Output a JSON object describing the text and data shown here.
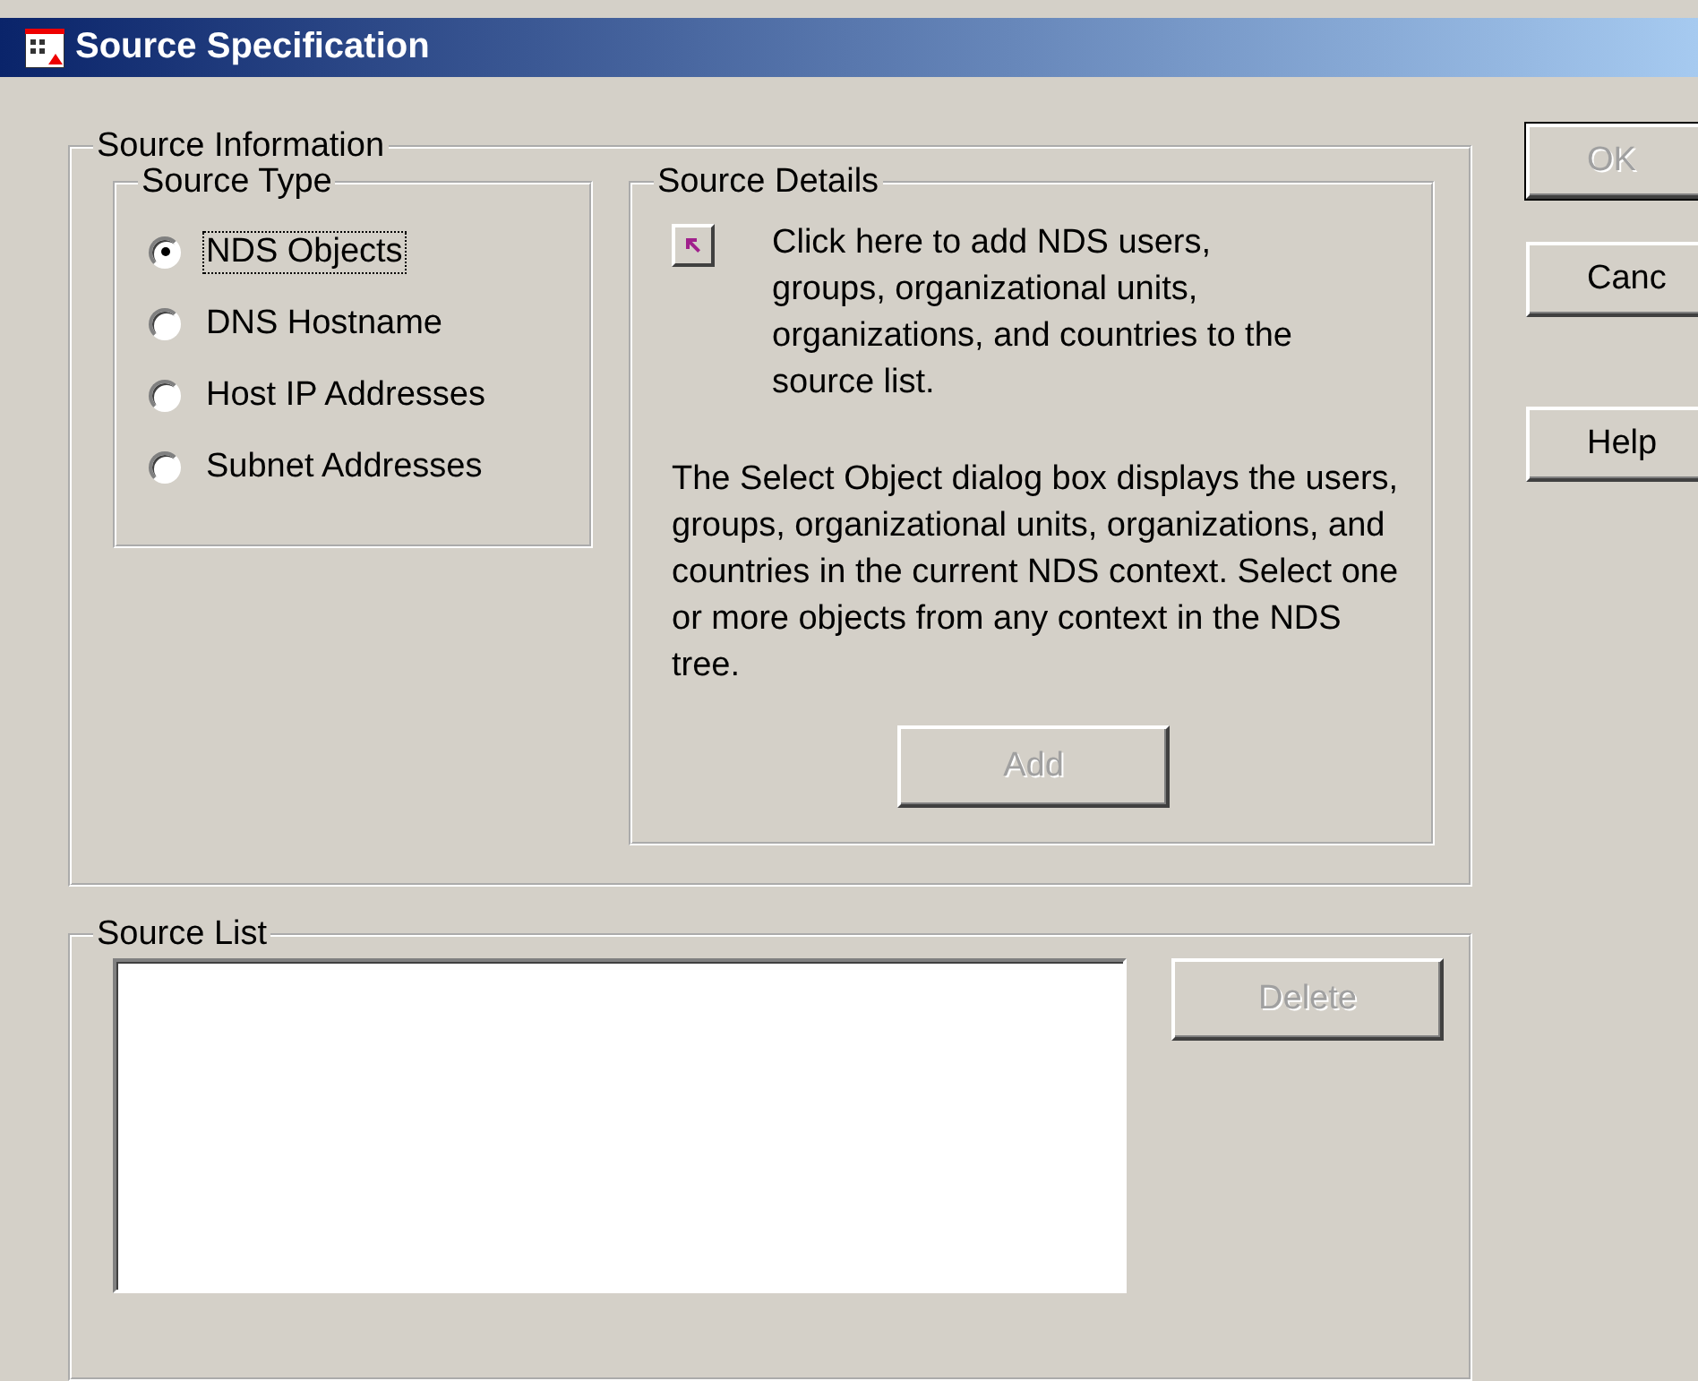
{
  "window": {
    "title": "Source Specification"
  },
  "source_information": {
    "title": "Source Information",
    "source_type": {
      "title": "Source Type",
      "options": [
        {
          "label": "NDS Objects",
          "selected": true,
          "focused": true
        },
        {
          "label": "DNS Hostname",
          "selected": false,
          "focused": false
        },
        {
          "label": "Host IP Addresses",
          "selected": false,
          "focused": false
        },
        {
          "label": "Subnet Addresses",
          "selected": false,
          "focused": false
        }
      ]
    },
    "source_details": {
      "title": "Source Details",
      "hint": "Click here to add NDS users, groups, organizational units, organizations, and countries to the source list.",
      "description": "The Select Object dialog box displays the users, groups, organizational units, organizations, and countries in the current NDS context.  Select one or more objects from any context in the NDS tree.",
      "add_button": {
        "label": "Add",
        "disabled": true
      }
    }
  },
  "source_list": {
    "title": "Source List",
    "delete_button": {
      "label": "Delete",
      "disabled": true
    }
  },
  "buttons": [
    {
      "label": "OK",
      "disabled": true,
      "default": true
    },
    {
      "label": "Canc",
      "disabled": false,
      "default": false
    },
    {
      "label": "Help",
      "disabled": false,
      "default": false
    }
  ]
}
